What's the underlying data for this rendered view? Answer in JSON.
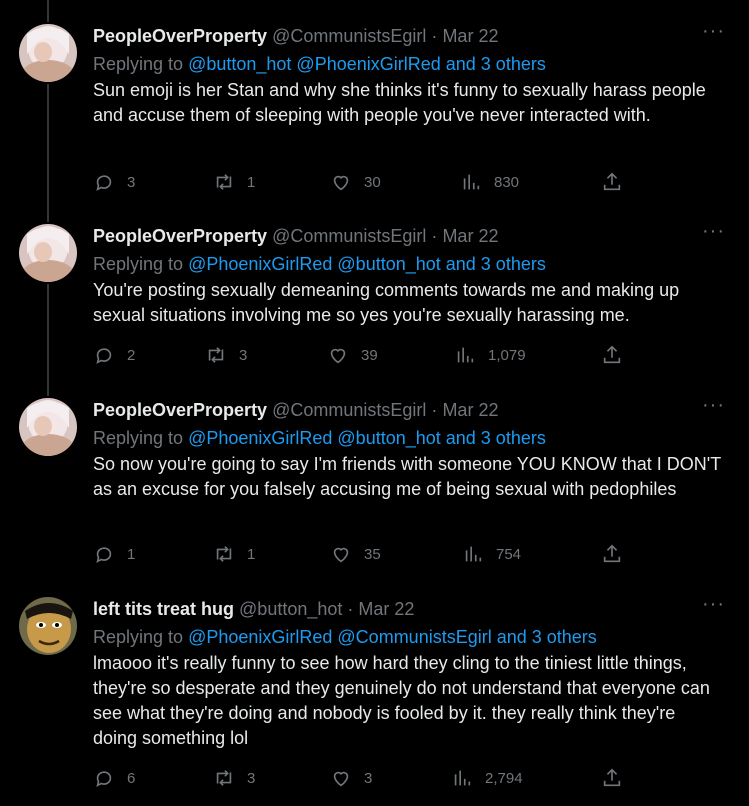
{
  "tweets": [
    {
      "name": "PeopleOverProperty",
      "handle": "@CommunistsEgirl",
      "sep": "·",
      "date": "Mar 22",
      "replying_prefix": "Replying to",
      "replying_to": "@button_hot @PhoenixGirlRed and 3 others",
      "text": "Sun emoji is her Stan and why she thinks it's funny to sexually harass people and accuse them of sleeping with people you've never interacted with.",
      "replies": "3",
      "retweets": "1",
      "likes": "30",
      "views": "830",
      "avatar": "pink-haired-woman"
    },
    {
      "name": "PeopleOverProperty",
      "handle": "@CommunistsEgirl",
      "sep": "·",
      "date": "Mar 22",
      "replying_prefix": "Replying to",
      "replying_to": "@PhoenixGirlRed @button_hot and 3 others",
      "text": "You're posting sexually demeaning comments towards me and making up sexual situations involving me so yes you're sexually harassing me.",
      "replies": "2",
      "retweets": "3",
      "likes": "39",
      "views": "1,079",
      "avatar": "pink-haired-woman"
    },
    {
      "name": "PeopleOverProperty",
      "handle": "@CommunistsEgirl",
      "sep": "·",
      "date": "Mar 22",
      "replying_prefix": "Replying to",
      "replying_to": "@PhoenixGirlRed @button_hot and 3 others",
      "text": "So now you're going to say I'm friends with someone YOU KNOW that I DON'T as an excuse for you falsely accusing me of being sexual with pedophiles",
      "replies": "1",
      "retweets": "1",
      "likes": "35",
      "views": "754",
      "avatar": "pink-haired-woman"
    },
    {
      "name": "left tits treat hug",
      "handle": "@button_hot",
      "sep": "·",
      "date": "Mar 22",
      "replying_prefix": "Replying to",
      "replying_to": "@PhoenixGirlRed @CommunistsEgirl and 3 others",
      "text": "lmaooo it's really funny to see how hard they cling to the tiniest little things, they're so desperate and they genuinely do not understand that everyone can see what they're doing and nobody is fooled by it. they really think they're doing something lol",
      "replies": "6",
      "retweets": "3",
      "likes": "3",
      "views": "2,794",
      "avatar": "cartoon-face"
    }
  ],
  "colors": {
    "background": "#000000",
    "text": "#e7e9ea",
    "muted": "#71767b",
    "link": "#1d9bf0",
    "line": "#333639"
  }
}
